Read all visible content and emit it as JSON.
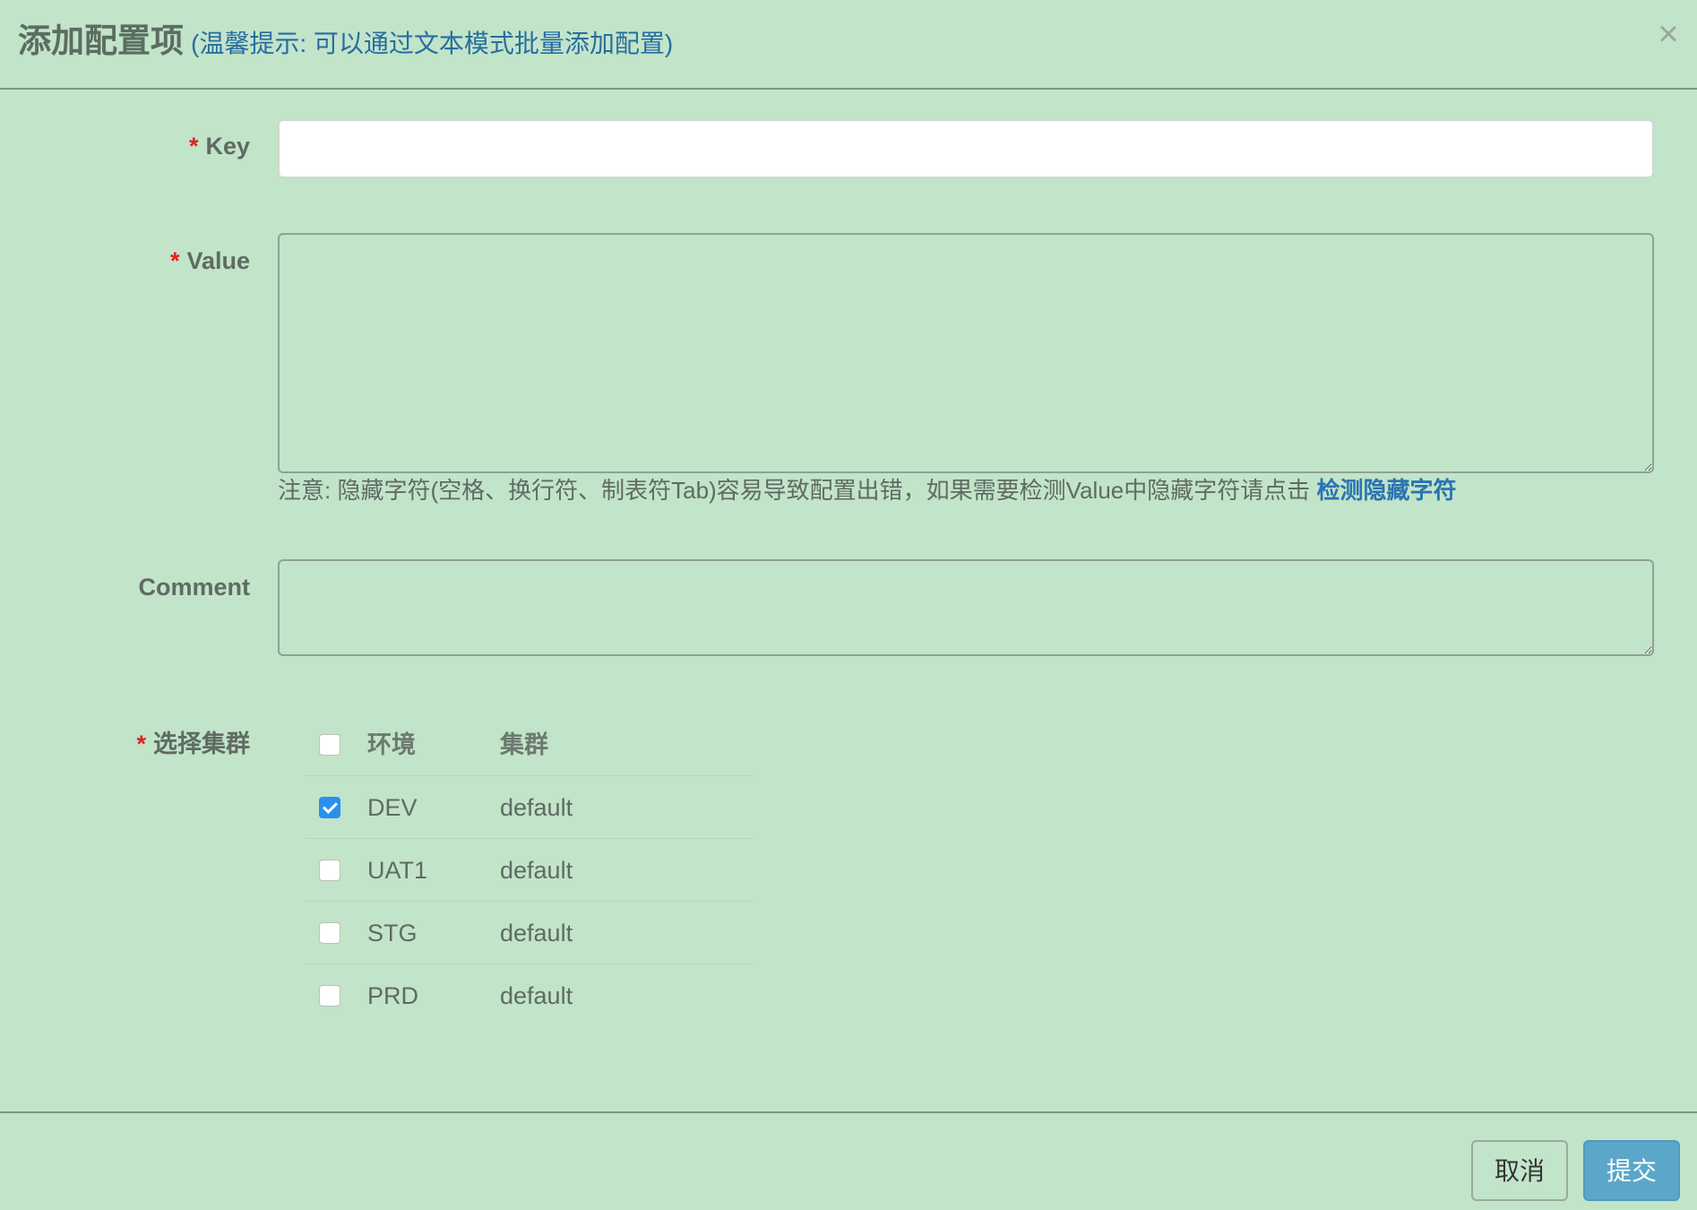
{
  "modal": {
    "title": "添加配置项",
    "hint": "(温馨提示: 可以通过文本模式批量添加配置)",
    "close_glyph": "×"
  },
  "form": {
    "required_mark": "*",
    "key_label": "Key",
    "key_value": "",
    "value_label": "Value",
    "value_value": "",
    "note_text": "注意: 隐藏字符(空格、换行符、制表符Tab)容易导致配置出错，如果需要检测Value中隐藏字符请点击 ",
    "note_link": "检测隐藏字符",
    "comment_label": "Comment",
    "comment_value": "",
    "cluster_label": "选择集群"
  },
  "clusters": {
    "header_env": "环境",
    "header_cluster": "集群",
    "header_checked": false,
    "rows": [
      {
        "env": "DEV",
        "cluster": "default",
        "checked": true
      },
      {
        "env": "UAT1",
        "cluster": "default",
        "checked": false
      },
      {
        "env": "STG",
        "cluster": "default",
        "checked": false
      },
      {
        "env": "PRD",
        "cluster": "default",
        "checked": false
      }
    ]
  },
  "footer": {
    "cancel_label": "取消",
    "submit_label": "提交"
  },
  "colors": {
    "background": "#c2e4c9",
    "required": "#e0211c",
    "link": "#2a74b3",
    "hint": "#276da0",
    "checkbox_checked": "#2b8ff0",
    "submit_button": "#5aa7c9"
  },
  "icons": {
    "close": "close-icon",
    "checkmark": "checkmark-icon"
  }
}
